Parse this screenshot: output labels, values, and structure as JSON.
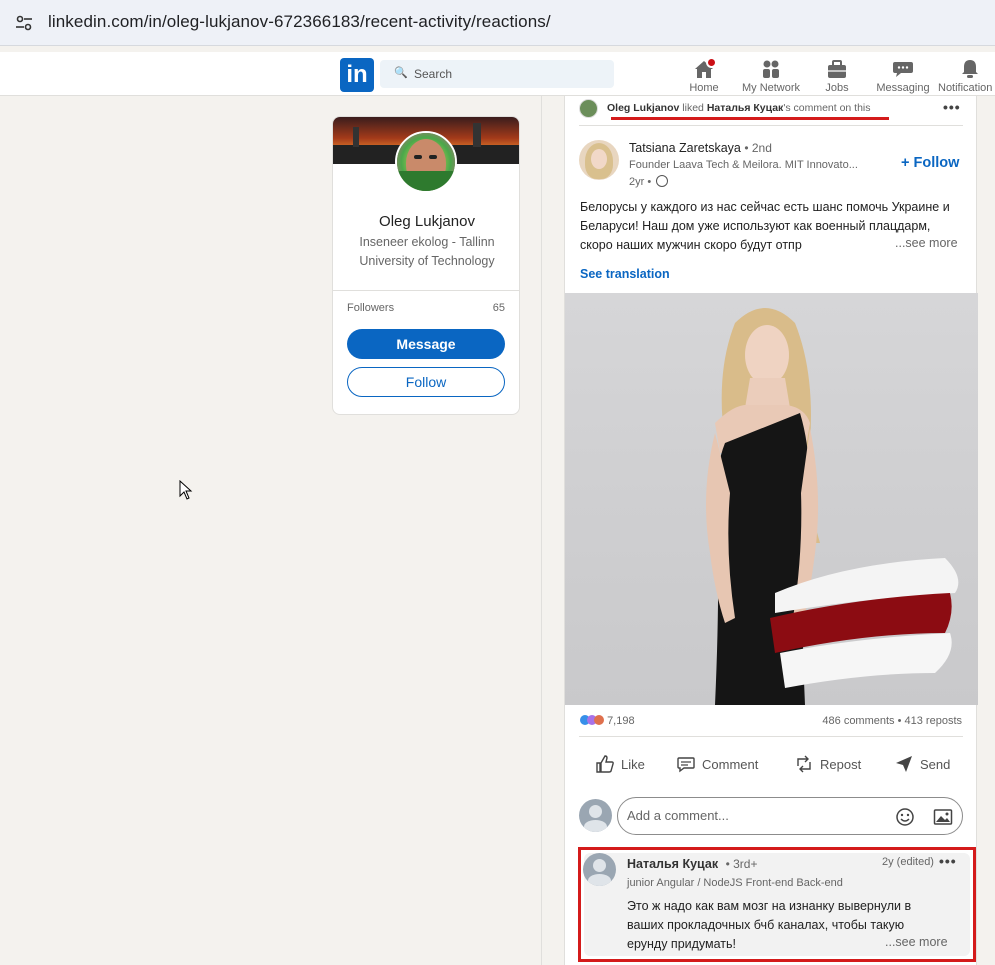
{
  "browser": {
    "url": "linkedin.com/in/oleg-lukjanov-672366183/recent-activity/reactions/"
  },
  "nav": {
    "logo": "in",
    "search_placeholder": "Search",
    "items": [
      {
        "label": "Home",
        "icon": "home-icon"
      },
      {
        "label": "My Network",
        "icon": "network-icon"
      },
      {
        "label": "Jobs",
        "icon": "briefcase-icon"
      },
      {
        "label": "Messaging",
        "icon": "messaging-icon"
      },
      {
        "label": "Notification",
        "icon": "bell-icon"
      }
    ]
  },
  "profile_card": {
    "name": "Oleg Lukjanov",
    "headline": "Inseneer ekolog - Tallinn University of Technology",
    "followers_label": "Followers",
    "followers_count": "65",
    "message_label": "Message",
    "follow_label": "Follow"
  },
  "activity": {
    "actor": "Oleg Lukjanov",
    "verb": "liked",
    "target": "Наталья Куцак",
    "suffix": "'s comment on this"
  },
  "post": {
    "author": "Tatsiana Zaretskaya",
    "degree": "• 2nd",
    "headline": "Founder Laava Tech & Meilora. MIT Innovato...",
    "time": "2yr •",
    "follow_label": "+ Follow",
    "body": "Белорусы у каждого из нас сейчас есть шанс помочь Украине и Беларуси! Наш дом уже используют как военный плацдарм, скоро наших мужчин скоро будут отпр",
    "see_more": "...see more",
    "see_translation": "See translation",
    "reactions_count": "7,198",
    "comments_reposts": "486 comments • 413 reposts",
    "actions": [
      "Like",
      "Comment",
      "Repost",
      "Send"
    ],
    "comment_placeholder": "Add a comment..."
  },
  "comment": {
    "author": "Наталья Куцак",
    "degree": "• 3rd+",
    "meta": "2y (edited)",
    "headline": "junior Angular / NodeJS Front-end Back-end",
    "text": "Это ж надо как вам мозг на изнанку вывернули в ваших прокладочных бчб каналах, чтобы такую ерунду придумать!",
    "see_more": "...see more"
  },
  "colors": {
    "linkedin_blue": "#0a66c2",
    "annotation_red": "#d41b1b",
    "page_bg": "#f4f2ee"
  }
}
